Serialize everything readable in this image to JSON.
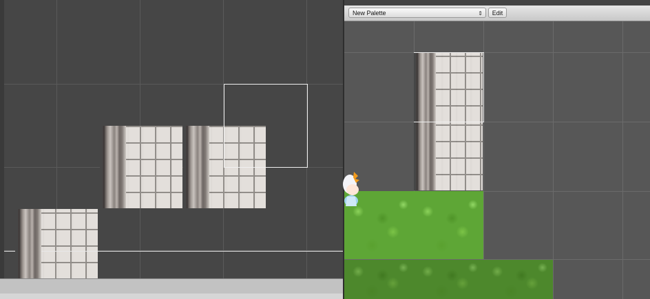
{
  "palette": {
    "selected_palette": "New Palette",
    "select_arrows": "⇕",
    "edit_label": "Edit"
  },
  "colors": {
    "scene_background": "#464646",
    "palette_background": "#575757",
    "grass": "#5ea636",
    "wall": "#ddd8d4",
    "selection": "#f0f0f0"
  }
}
